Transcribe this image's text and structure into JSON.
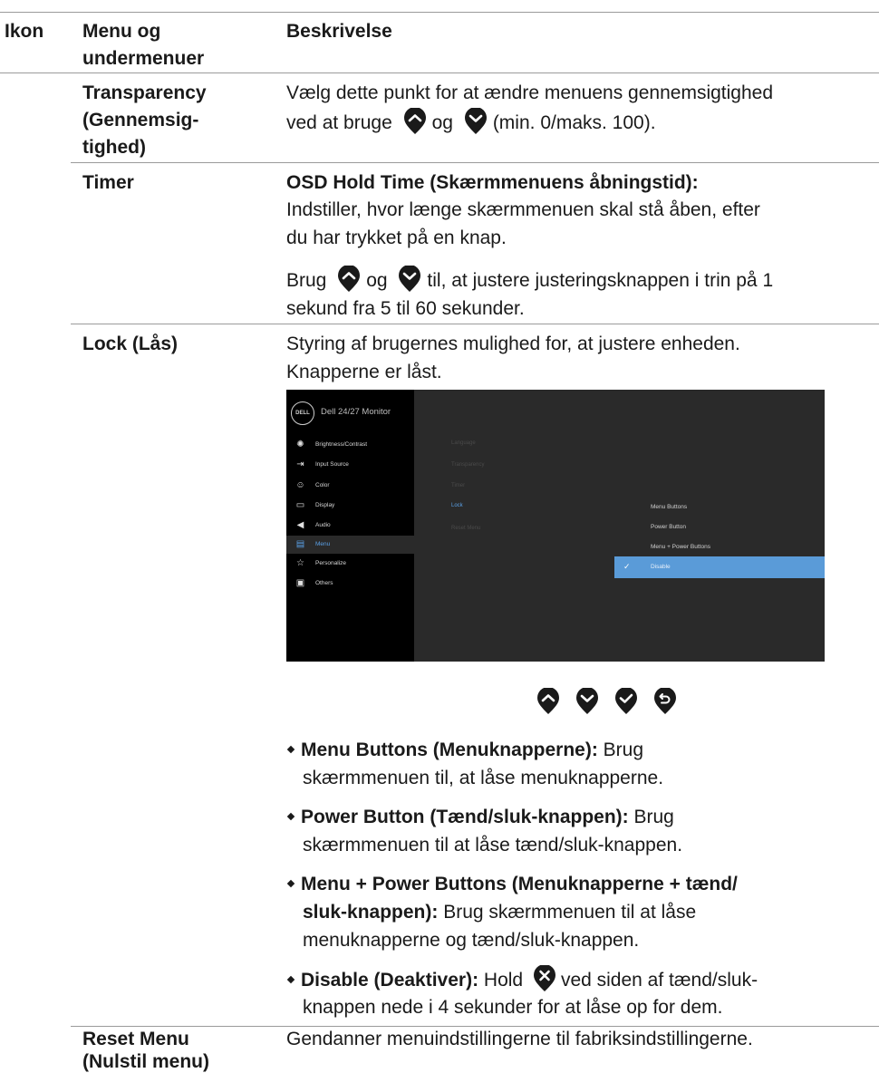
{
  "header": {
    "col_icon": "Ikon",
    "col_menu_line1": "Menu og",
    "col_menu_line2": "undermenuer",
    "col_desc": "Beskrivelse"
  },
  "transparency": {
    "name_line1": "Transparency",
    "name_line2": "(Gennemsig-",
    "name_line3": "tighed)",
    "desc_line1": "Vælg dette punkt for at ændre menuens gennemsigtighed",
    "desc_line2_a": "ved at bruge",
    "desc_line2_b": "og",
    "desc_line2_c": "(min. 0/maks. 100)."
  },
  "timer": {
    "name": "Timer",
    "heading": "OSD Hold Time (Skærmmenuens åbningstid):",
    "desc_line1": "Indstiller, hvor længe skærmmenuen skal stå åben, efter",
    "desc_line2": "du har trykket på en knap.",
    "use_a": "Brug",
    "use_b": "og",
    "use_c": "til, at justere justeringsknappen i trin på 1",
    "use_line2": "sekund fra 5 til 60 sekunder."
  },
  "lock": {
    "name": "Lock (Lås)",
    "desc_line1": "Styring af brugernes mulighed for, at justere enheden.",
    "desc_line2": "Knapperne er låst.",
    "bullets": [
      {
        "bold": "Menu Buttons (Menuknapperne):",
        "text_a": " Brug",
        "text_line2": "skærmmenuen til, at låse menuknapperne."
      },
      {
        "bold": "Power Button (Tænd/sluk-knappen):",
        "text_a": " Brug",
        "text_line2": "skærmmenuen til at låse tænd/sluk-knappen."
      },
      {
        "bold": "Menu + Power Buttons (Menuknapperne + tænd/",
        "bold_line2": "sluk-knappen):",
        "text_a": " Brug skærmmenuen til at låse",
        "text_line3": "menuknapperne og tænd/sluk-knappen."
      },
      {
        "bold": "Disable (Deaktiver):",
        "text_a": " Hold",
        "text_b": "ved siden af tænd/sluk-",
        "text_line2": "knappen nede i 4 sekunder for at låse op for dem."
      }
    ]
  },
  "osd": {
    "logo": "DELL",
    "title": "Dell 24/27 Monitor",
    "menu": [
      {
        "label": "Brightness/Contrast",
        "icon": "sun-icon"
      },
      {
        "label": "Input Source",
        "icon": "input-icon"
      },
      {
        "label": "Color",
        "icon": "palette-icon"
      },
      {
        "label": "Display",
        "icon": "monitor-icon"
      },
      {
        "label": "Audio",
        "icon": "speaker-icon"
      },
      {
        "label": "Menu",
        "icon": "menu-icon"
      },
      {
        "label": "Personalize",
        "icon": "star-icon"
      },
      {
        "label": "Others",
        "icon": "others-icon"
      }
    ],
    "submenu": [
      "Language",
      "Transparency",
      "Timer",
      "Lock",
      "Reset Menu"
    ],
    "options": [
      "Menu Buttons",
      "Power Button",
      "Menu + Power Buttons",
      "Disable"
    ]
  },
  "reset": {
    "name_line1": "Reset Menu",
    "name_line2": "(Nulstil menu)",
    "desc": "Gendanner menuindstillingerne til fabriksindstillingerne."
  },
  "colors": {
    "accent": "#5a9bd8",
    "icon_fill": "#1a1a1a"
  }
}
